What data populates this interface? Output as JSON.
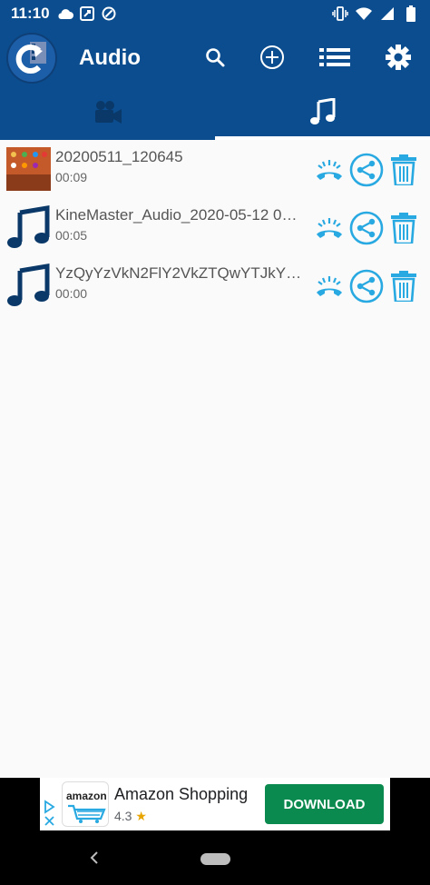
{
  "status_bar": {
    "time": "11:10",
    "left_icons": [
      "cloud-icon",
      "screenshot-icon",
      "data-saver-icon"
    ],
    "right_icons": [
      "vibrate-icon",
      "wifi-icon",
      "signal-icon",
      "battery-icon"
    ]
  },
  "app_bar": {
    "title": "Audio",
    "actions": [
      "search-icon",
      "add-circle-icon",
      "list-icon",
      "settings-icon"
    ]
  },
  "tabs": [
    {
      "name": "video",
      "icon": "video-camera-icon",
      "selected": false
    },
    {
      "name": "audio",
      "icon": "music-note-icon",
      "selected": true
    }
  ],
  "files": [
    {
      "name": "20200511_120645",
      "duration": "00:09",
      "thumb": "screenshot-thumbnail"
    },
    {
      "name": "KineMaster_Audio_2020-05-12 0…",
      "duration": "00:05",
      "thumb": "music-note-icon"
    },
    {
      "name": "YzQyYzVkN2FlY2VkZTQwYTJkYT…",
      "duration": "00:00",
      "thumb": "music-note-icon"
    }
  ],
  "row_actions": [
    "ringtone-icon",
    "share-icon",
    "delete-icon"
  ],
  "ad": {
    "logo_text": "amazon",
    "title": "Amazon Shopping",
    "rating": "4.3",
    "button": "DOWNLOAD"
  },
  "colors": {
    "app_bar": "#0b4d8e",
    "accent": "#29a9e1",
    "ad_button": "#0a8a4e"
  }
}
